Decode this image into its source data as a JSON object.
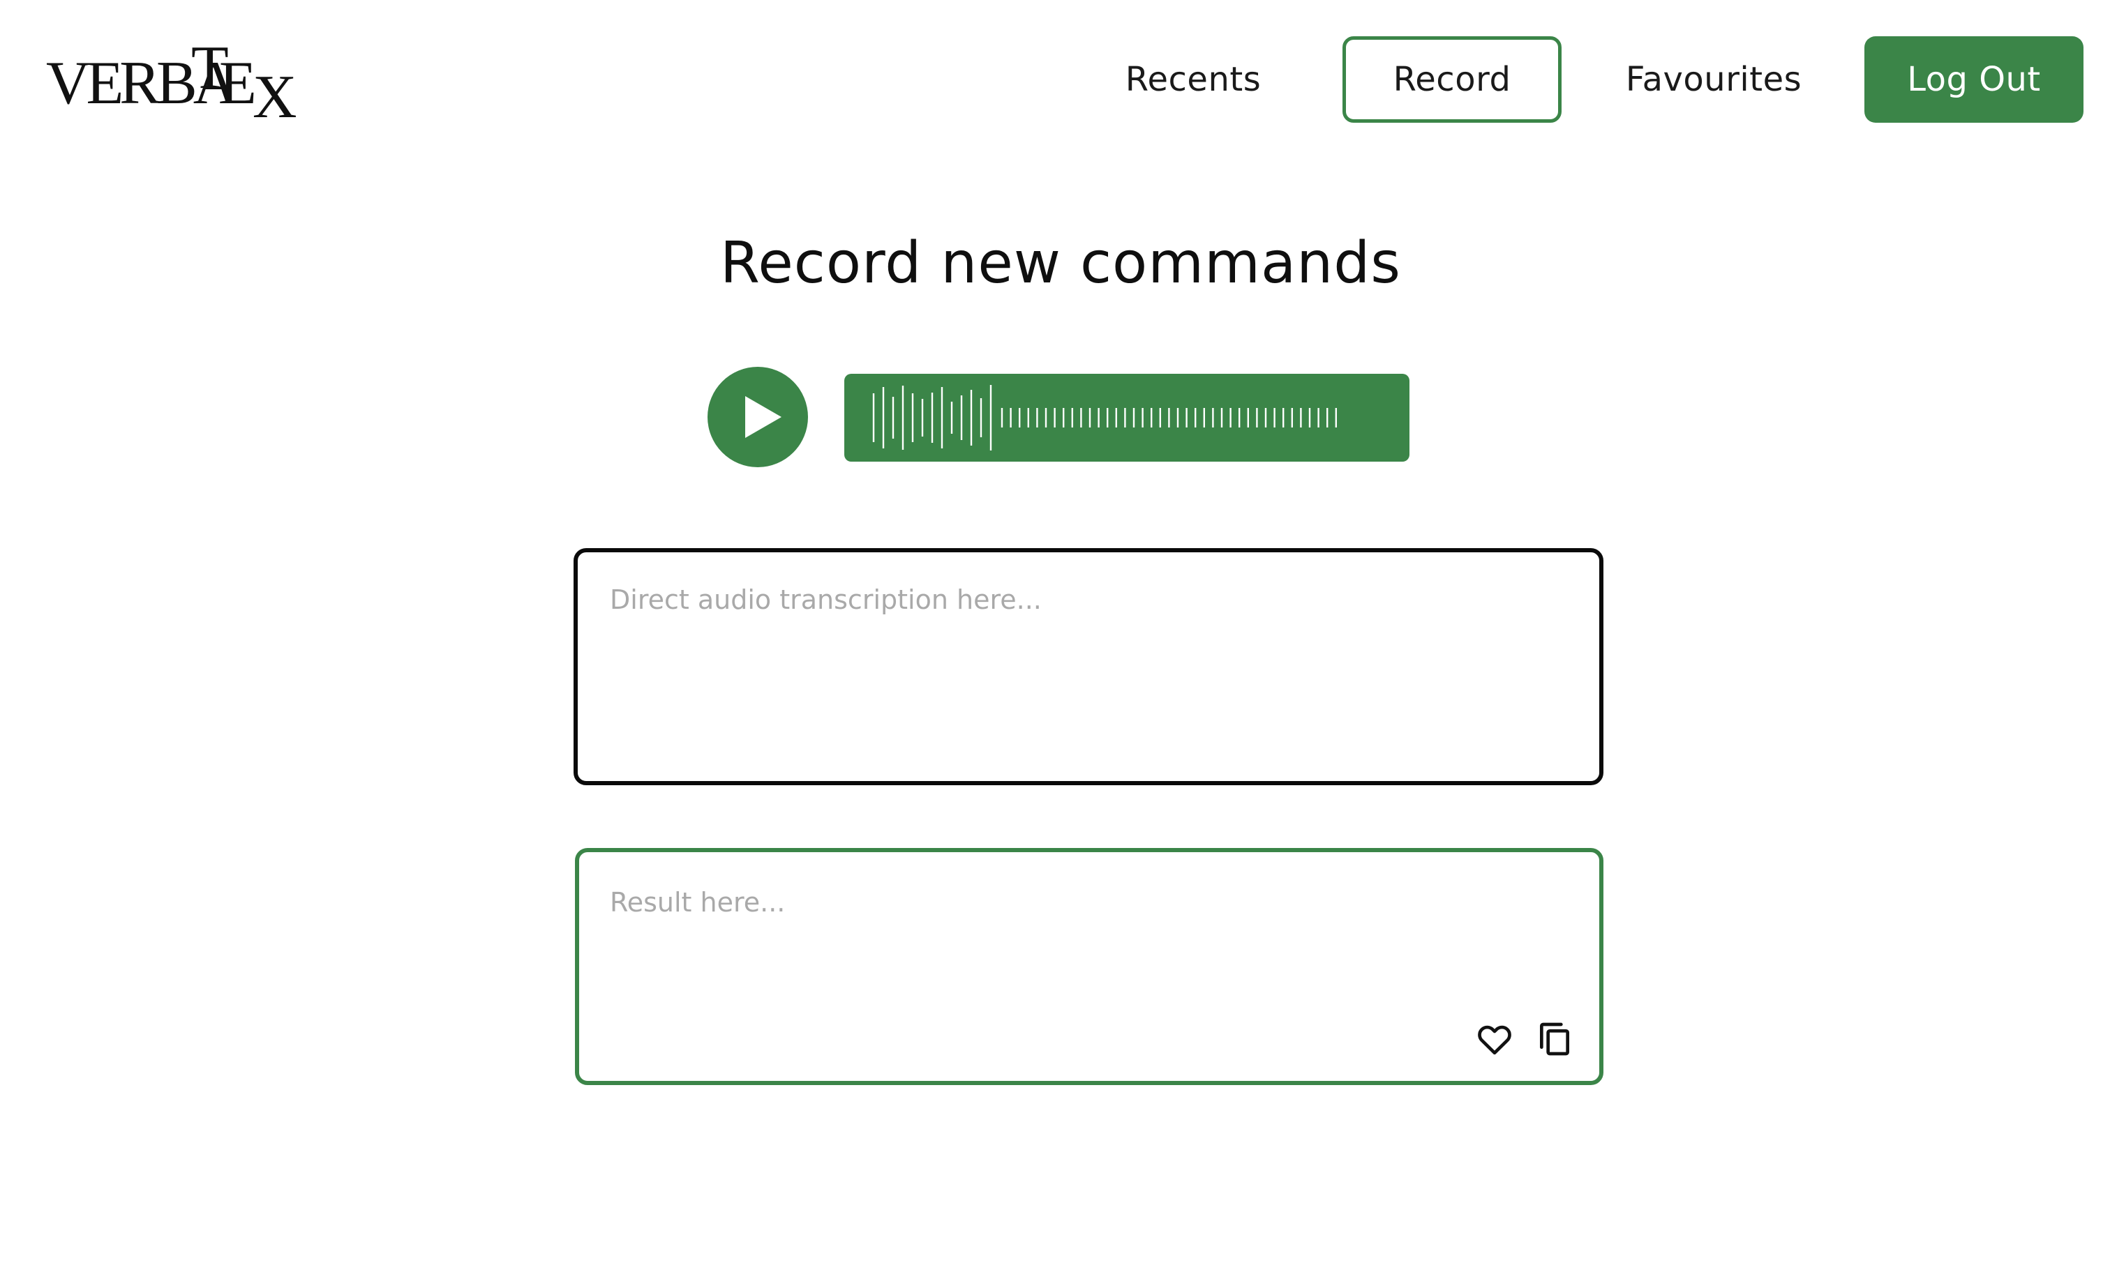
{
  "brand": {
    "logo_text": "VERBATEX",
    "accent_color": "#3b8548"
  },
  "nav": {
    "recents": "Recents",
    "record": "Record",
    "favourites": "Favourites",
    "logout": "Log Out",
    "active": "Record"
  },
  "main": {
    "title": "Record new commands",
    "player": {
      "play_icon": "play-icon",
      "waveform_icon": "waveform"
    },
    "transcription": {
      "placeholder": "Direct audio transcription here..."
    },
    "result": {
      "placeholder": "Result here...",
      "actions": [
        {
          "icon": "heart-icon"
        },
        {
          "icon": "copy-icon"
        }
      ]
    }
  }
}
